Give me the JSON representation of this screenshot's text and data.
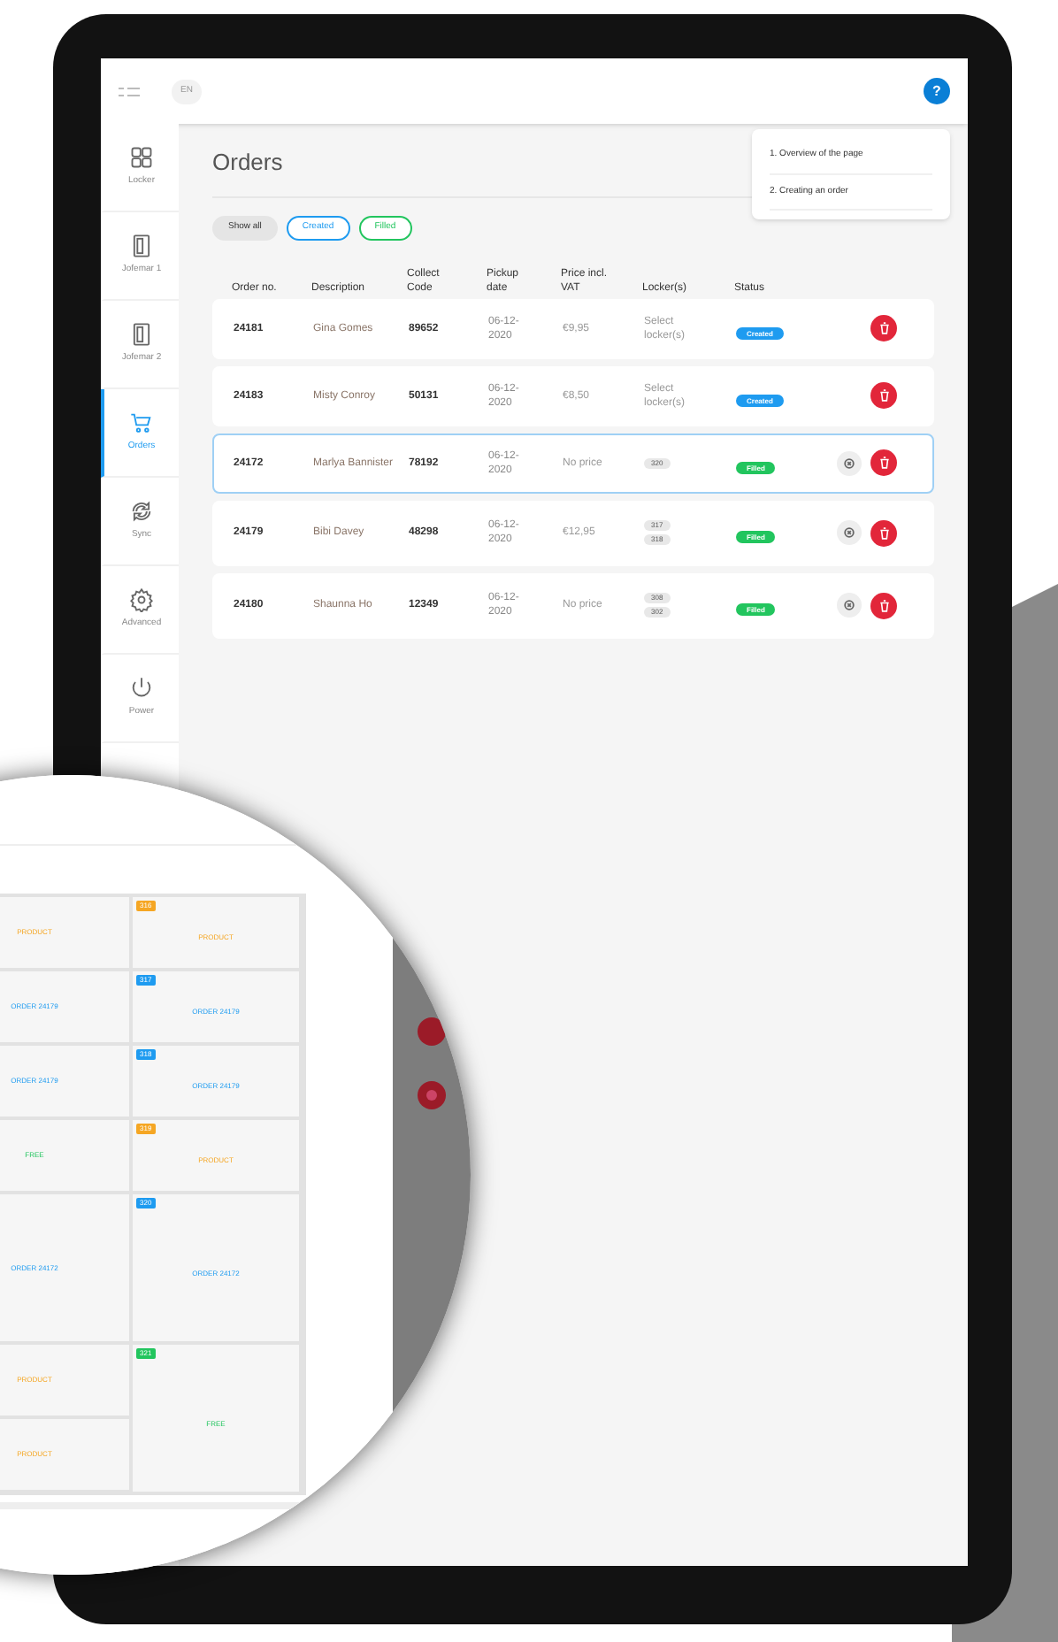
{
  "topbar": {
    "language": "EN",
    "help": "?"
  },
  "sidebar": {
    "items": [
      {
        "label": "Locker",
        "selected": false
      },
      {
        "label": "Jofemar 1",
        "selected": false
      },
      {
        "label": "Jofemar 2",
        "selected": false
      },
      {
        "label": "Orders",
        "selected": true
      },
      {
        "label": "Sync",
        "selected": false
      },
      {
        "label": "Advanced",
        "selected": false
      },
      {
        "label": "Power",
        "selected": false
      }
    ]
  },
  "help_menu": {
    "items": [
      "1.  Overview of the page",
      "2.  Creating an order"
    ]
  },
  "title": "Orders",
  "filters": [
    {
      "label": "Show all",
      "kind": "all"
    },
    {
      "label": "Created",
      "kind": "created"
    },
    {
      "label": "Filled",
      "kind": "filled"
    }
  ],
  "table": {
    "columns": [
      "Order no.",
      "Description",
      "Collect Code",
      "Pickup date",
      "Price incl. VAT",
      "Locker(s)",
      "Status"
    ],
    "rows": [
      {
        "order": "24181",
        "description": "Gina Gomes",
        "code": "89652",
        "date": "06-12-2020",
        "price": "€9,95",
        "lockers_text": "Select locker(s)",
        "lockers": [],
        "status": "Created",
        "kind": "created",
        "cancellable": false,
        "selected": false
      },
      {
        "order": "24183",
        "description": "Misty Conroy",
        "code": "50131",
        "date": "06-12-2020",
        "price": "€8,50",
        "lockers_text": "Select locker(s)",
        "lockers": [],
        "status": "Created",
        "kind": "created",
        "cancellable": false,
        "selected": false
      },
      {
        "order": "24172",
        "description": "Marlya Bannister",
        "code": "78192",
        "date": "06-12-2020",
        "price": "No price",
        "lockers": [
          "320"
        ],
        "status": "Filled",
        "kind": "filled",
        "cancellable": true,
        "selected": true
      },
      {
        "order": "24179",
        "description": "Bibi Davey",
        "code": "48298",
        "date": "06-12-2020",
        "price": "€12,95",
        "lockers": [
          "317",
          "318"
        ],
        "status": "Filled",
        "kind": "filled",
        "cancellable": true,
        "selected": false
      },
      {
        "order": "24180",
        "description": "Shaunna Ho",
        "code": "12349",
        "date": "06-12-2020",
        "price": "No price",
        "lockers": [
          "308",
          "302"
        ],
        "status": "Filled",
        "kind": "filled",
        "cancellable": true,
        "selected": false
      }
    ]
  },
  "magnifier": {
    "left_cells": [
      {
        "text": "PRODUCT",
        "kind": "product",
        "tall": false
      },
      {
        "text": "ORDER 24179",
        "kind": "order",
        "tall": false
      },
      {
        "text": "ORDER 24179",
        "kind": "order",
        "tall": false
      },
      {
        "text": "FREE",
        "kind": "free",
        "tall": false
      },
      {
        "text": "ORDER 24172",
        "kind": "order",
        "tall": true
      },
      {
        "text": "PRODUCT",
        "kind": "product",
        "tall": false
      },
      {
        "text": "PRODUCT",
        "kind": "product",
        "tall": false
      }
    ],
    "right_cells": [
      {
        "badge": "316",
        "text": "PRODUCT",
        "kind": "product",
        "tall": false
      },
      {
        "badge": "317",
        "text": "ORDER 24179",
        "kind": "order",
        "tall": false
      },
      {
        "badge": "318",
        "text": "ORDER 24179",
        "kind": "order",
        "tall": false
      },
      {
        "badge": "319",
        "text": "PRODUCT",
        "kind": "product",
        "tall": false
      },
      {
        "badge": "320",
        "text": "ORDER 24172",
        "kind": "order",
        "tall": true
      },
      {
        "badge": "321",
        "text": "FREE",
        "kind": "free",
        "tall": true
      }
    ]
  }
}
